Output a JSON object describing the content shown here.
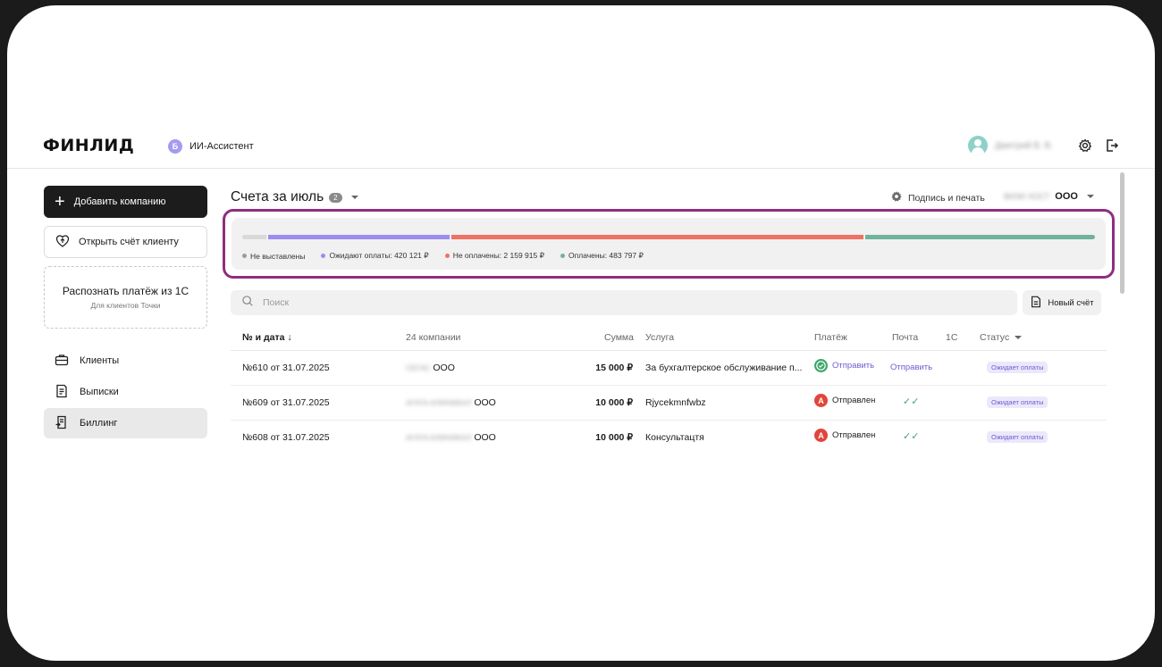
{
  "header": {
    "logo": "ФИНЛИД",
    "assistant_label": "ИИ-Ассистент",
    "assistant_badge": "Б",
    "user_name": "Дмитрий В. В."
  },
  "sidebar": {
    "add_company": "Добавить компанию",
    "open_invoice": "Открыть счёт клиенту",
    "recognize_title": "Распознать платёж из 1С",
    "recognize_subtitle": "Для клиентов Точки",
    "nav": [
      {
        "label": "Клиенты",
        "icon": "briefcase-icon"
      },
      {
        "label": "Выписки",
        "icon": "statement-icon"
      },
      {
        "label": "Биллинг",
        "icon": "billing-icon",
        "active": true
      }
    ]
  },
  "main": {
    "title": "Счета за июль",
    "count": "2",
    "sign_print": "Подпись и печать",
    "org_blur": "ВИЗИ ХОСТ",
    "org_type": "ООО"
  },
  "summary": {
    "segments": [
      {
        "label": "Не выставлены",
        "color": "#d9d9d9",
        "value_text": "",
        "dot": "#9a9a9a",
        "share": 0.028
      },
      {
        "label": "Ожидают оплаты: 420 121 ₽",
        "color": "#9b8cf0",
        "dot": "#9b8cf0",
        "share": 0.214
      },
      {
        "label": "Не оплачены: 2 159 915 ₽",
        "color": "#ef7264",
        "dot": "#ef7264",
        "share": 0.487
      },
      {
        "label": "Оплачены: 483 797 ₽",
        "color": "#6fb39a",
        "dot": "#6fb39a",
        "share": 0.271
      }
    ]
  },
  "search": {
    "placeholder": "Поиск",
    "new_invoice": "Новый счёт"
  },
  "table": {
    "headers": {
      "number_date": "№ и дата",
      "companies": "24 компании",
      "sum": "Сумма",
      "service": "Услуга",
      "payment": "Платёж",
      "mail": "Почта",
      "onec": "1С",
      "status": "Статус"
    },
    "rows": [
      {
        "number": "№610 от 31.07.2025",
        "company_blur": "СЕГАС",
        "company_type": "ООО",
        "sum": "15 000 ₽",
        "service": "За бухгалтерское обслуживание п...",
        "payment_icon": "check",
        "payment_color": "#3fa66b",
        "payment": "Отправить",
        "payment_link": true,
        "mail": "Отправить",
        "mail_link": true,
        "status": "Ожидает оплаты"
      },
      {
        "number": "№609 от 31.07.2025",
        "company_blur": "АГАТА-КЛИНИКАЛ",
        "company_type": "ООО",
        "sum": "10 000 ₽",
        "service": "Rjycekmnfwbz",
        "payment_icon": "А",
        "payment_color": "#e0463b",
        "payment": "Отправлен",
        "payment_link": false,
        "mail": "✓✓",
        "mail_link": false,
        "status": "Ожидает оплаты"
      },
      {
        "number": "№608 от 31.07.2025",
        "company_blur": "АГАТА-КЛИНИКАЛ",
        "company_type": "ООО",
        "sum": "10 000 ₽",
        "service": "Консультацтя",
        "payment_icon": "А",
        "payment_color": "#e0463b",
        "payment": "Отправлен",
        "payment_link": false,
        "mail": "✓✓",
        "mail_link": false,
        "status": "Ожидает оплаты"
      }
    ]
  }
}
